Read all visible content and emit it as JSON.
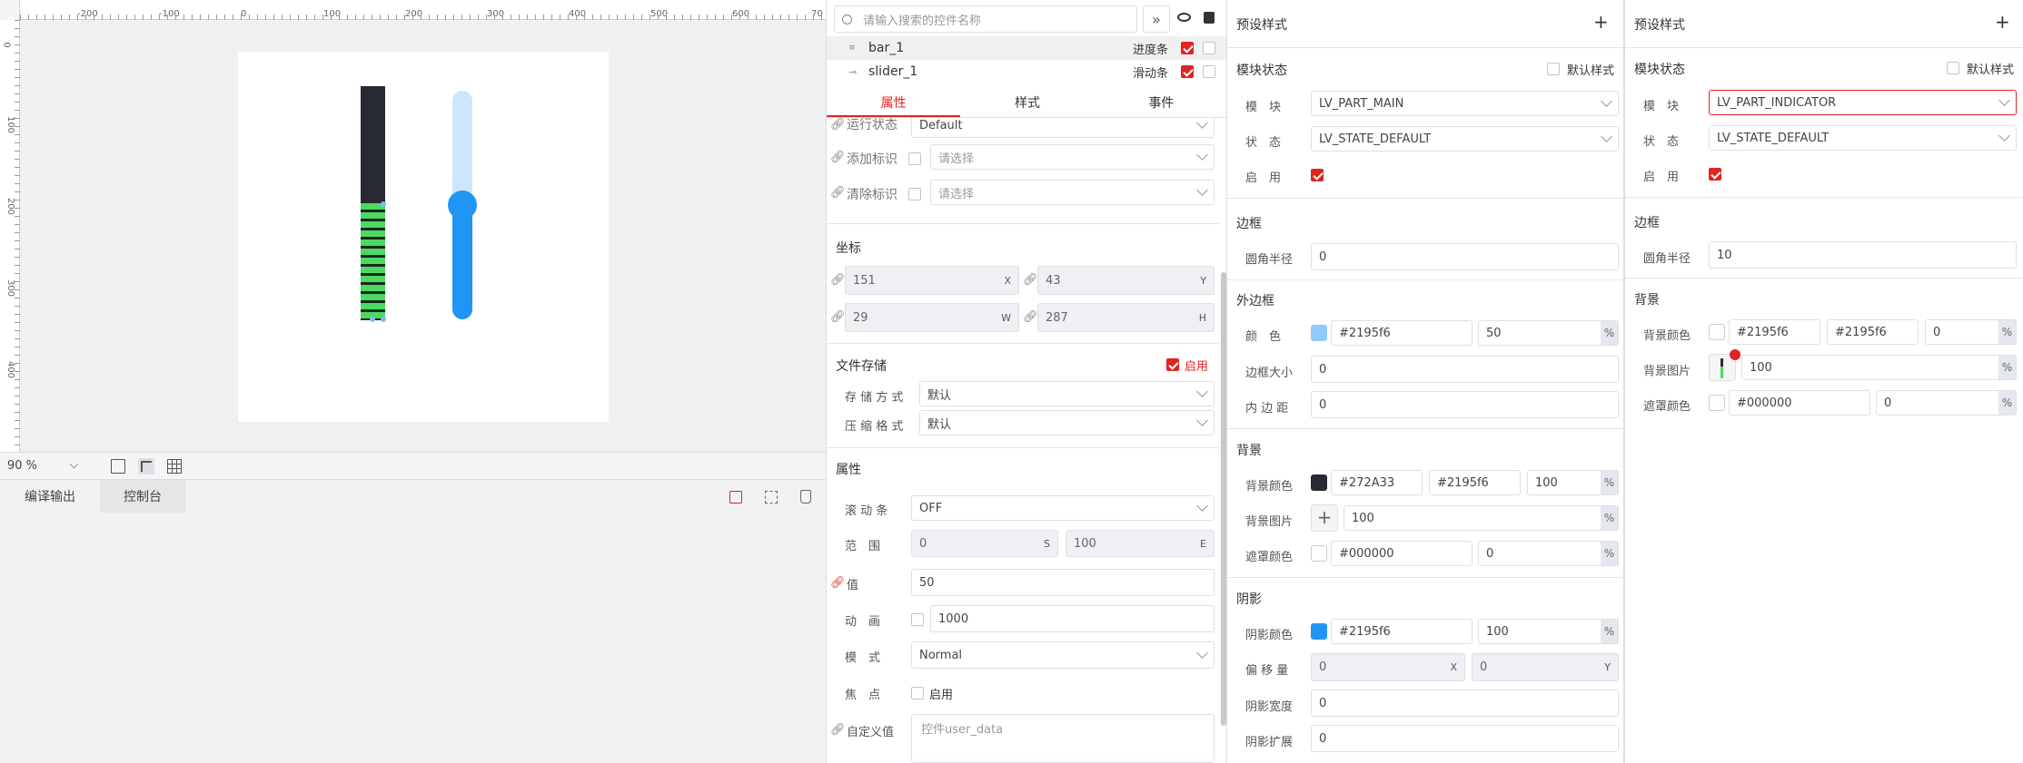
{
  "canvas": {
    "ruler_x": [
      "-200",
      "-100",
      "0",
      "100",
      "200",
      "300",
      "400",
      "500",
      "600",
      "70"
    ],
    "ruler_y": [
      "0",
      "100",
      "200",
      "300",
      "400"
    ],
    "zoom": "90 %",
    "bar_value": 50,
    "slider_value": 50
  },
  "bottom_tabs": {
    "output": "编译输出",
    "console": "控制台"
  },
  "tree": {
    "search_placeholder": "请输入搜索的控件名称",
    "items": [
      {
        "name": "bar_1",
        "type": "进度条"
      },
      {
        "name": "slider_1",
        "type": "滑动条"
      }
    ]
  },
  "tabs": {
    "props": "属性",
    "style": "样式",
    "events": "事件"
  },
  "props": {
    "run_state_label": "运行状态",
    "run_state": "Default",
    "add_flag_label": "添加标识",
    "add_flag": "请选择",
    "clear_flag_label": "清除标识",
    "clear_flag": "请选择",
    "coords_title": "坐标",
    "x": "151",
    "y": "43",
    "w": "29",
    "h": "287",
    "x_sfx": "X",
    "y_sfx": "Y",
    "w_sfx": "W",
    "h_sfx": "H",
    "file_title": "文件存储",
    "file_enable": "启用",
    "storage_label": "存 储 方 式",
    "storage": "默认",
    "compress_label": "压 缩 格 式",
    "compress": "默认",
    "attr_title": "属性",
    "scrollbar_label": "滚 动 条",
    "scrollbar": "OFF",
    "range_label": "范　围",
    "range_s": "0",
    "range_s_sfx": "S",
    "range_e": "100",
    "range_e_sfx": "E",
    "value_label": "值",
    "value": "50",
    "anim_label": "动　画",
    "anim": "1000",
    "mode_label": "模　式",
    "mode": "Normal",
    "focus_label": "焦　点",
    "focus_enable": "启用",
    "custom_label": "自定义值",
    "custom_placeholder": "控件user_data"
  },
  "style1": {
    "preset": "预设样式",
    "module_state": "模块状态",
    "default_style": "默认样式",
    "part_label": "模　块",
    "part": "LV_PART_MAIN",
    "state_label": "状　态",
    "state": "LV_STATE_DEFAULT",
    "enable_label": "启　用",
    "border_title": "边框",
    "radius_label": "圆角半径",
    "radius": "0",
    "outline_title": "外边框",
    "color_label": "颜　色",
    "outline_color": "#2195f6",
    "outline_opa": "50",
    "outline_size_label": "边框大小",
    "outline_size": "0",
    "padding_label": "内 边 距",
    "padding": "0",
    "bg_title": "背景",
    "bg_color_label": "背景颜色",
    "bg_color": "#272A33",
    "bg_grad": "#2195f6",
    "bg_opa": "100",
    "bg_img_label": "背景图片",
    "bg_img_opa": "100",
    "mask_label": "遮罩颜色",
    "mask_color": "#000000",
    "mask_opa": "0",
    "shadow_title": "阴影",
    "shadow_color_label": "阴影颜色",
    "shadow_color": "#2195f6",
    "shadow_opa": "100",
    "offset_label": "偏 移 量",
    "offset_x": "0",
    "offset_y": "0",
    "shadow_width_label": "阴影宽度",
    "shadow_width": "0",
    "shadow_spread_label": "阴影扩展",
    "shadow_spread": "0",
    "pct": "%",
    "x_sfx": "X",
    "y_sfx": "Y"
  },
  "style2": {
    "preset": "预设样式",
    "module_state": "模块状态",
    "default_style": "默认样式",
    "part_label": "模　块",
    "part": "LV_PART_INDICATOR",
    "state_label": "状　态",
    "state": "LV_STATE_DEFAULT",
    "enable_label": "启　用",
    "border_title": "边框",
    "radius_label": "圆角半径",
    "radius": "10",
    "bg_title": "背景",
    "bg_color_label": "背景颜色",
    "bg_color": "#2195f6",
    "bg_grad": "#2195f6",
    "bg_opa": "0",
    "bg_img_label": "背景图片",
    "bg_img_opa": "100",
    "mask_label": "遮罩颜色",
    "mask_color": "#000000",
    "mask_opa": "0",
    "pct": "%"
  },
  "colors": {
    "accent": "#e02424",
    "bar_bg": "#272A33",
    "bar_indicator": "#4cd964",
    "slider": "#2195f6",
    "slider_track": "#cde6fb",
    "canvas_bg": "#f0f0f0"
  }
}
